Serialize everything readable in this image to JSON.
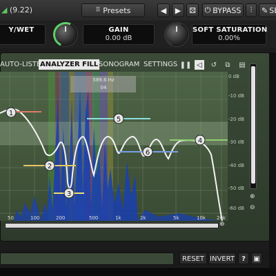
{
  "header": {
    "version": "(9.22)",
    "presets_label": "Presets",
    "bypass_label": "BYPASS",
    "settings_label_partial": "SE"
  },
  "params": [
    {
      "name": "Y/WET",
      "value": ""
    },
    {
      "name": "GAIN",
      "value": "0.00 dB"
    },
    {
      "name": "SOFT SATURATION",
      "value": "0.00%"
    }
  ],
  "tabs": {
    "auto_listen": "AUTO-LISTEN",
    "analyzer": "ANALYZER",
    "fill": "FILL",
    "sonogram": "SONOGRAM",
    "settings": "SETTINGS"
  },
  "graph": {
    "db_labels": [
      "0 dB",
      "-10 dB",
      "-20 dB",
      "-30 dB",
      "-40 dB",
      "-50 dB",
      "-60 dB"
    ],
    "freq_labels": [
      "50",
      "100",
      "200",
      "500",
      "1k",
      "2k",
      "5k",
      "10k",
      "20k"
    ],
    "band_numbers": [
      "1",
      "2",
      "3",
      "4",
      "5",
      "6"
    ],
    "overlay_text_1": "589.6 Hz",
    "overlay_text_2": "04"
  },
  "bottom": {
    "reset_label": "RESET",
    "invert_label": "INVERT",
    "help_label": "?"
  },
  "colors": {
    "curve": "#f2f2f2",
    "spectrum": "#1a3fb0",
    "panel": "#34432f",
    "knob_arc": "#5fd06a"
  }
}
